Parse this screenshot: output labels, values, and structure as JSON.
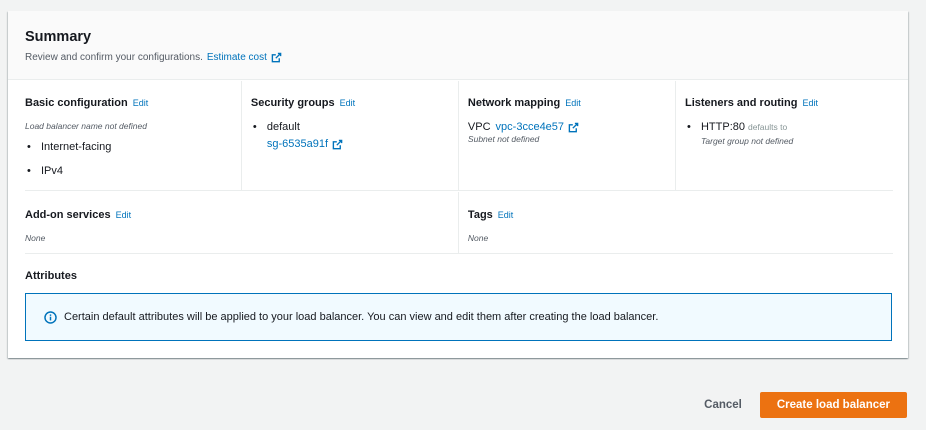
{
  "summary": {
    "title": "Summary",
    "description": "Review and confirm your configurations.",
    "estimate_link": "Estimate cost"
  },
  "basic_config": {
    "title": "Basic configuration",
    "edit": "Edit",
    "note": "Load balancer name not defined",
    "items": [
      "Internet-facing",
      "IPv4"
    ]
  },
  "security_groups": {
    "title": "Security groups",
    "edit": "Edit",
    "items": [
      "default"
    ],
    "group_id": "sg-6535a91f"
  },
  "network_mapping": {
    "title": "Network mapping",
    "edit": "Edit",
    "vpc_label": "VPC",
    "vpc_id": "vpc-3cce4e57",
    "subnet_note": "Subnet not defined"
  },
  "listeners": {
    "title": "Listeners and routing",
    "edit": "Edit",
    "listener": "HTTP:80",
    "defaults_to": "defaults to",
    "target_note": "Target group not defined"
  },
  "addons": {
    "title": "Add-on services",
    "edit": "Edit",
    "value": "None"
  },
  "tags": {
    "title": "Tags",
    "edit": "Edit",
    "value": "None"
  },
  "attributes": {
    "title": "Attributes",
    "info": "Certain default attributes will be applied to your load balancer. You can view and edit them after creating the load balancer."
  },
  "footer": {
    "cancel": "Cancel",
    "create": "Create load balancer"
  },
  "colors": {
    "link": "#0073bb",
    "primary": "#ec7211",
    "info_bg": "#f1faff"
  }
}
